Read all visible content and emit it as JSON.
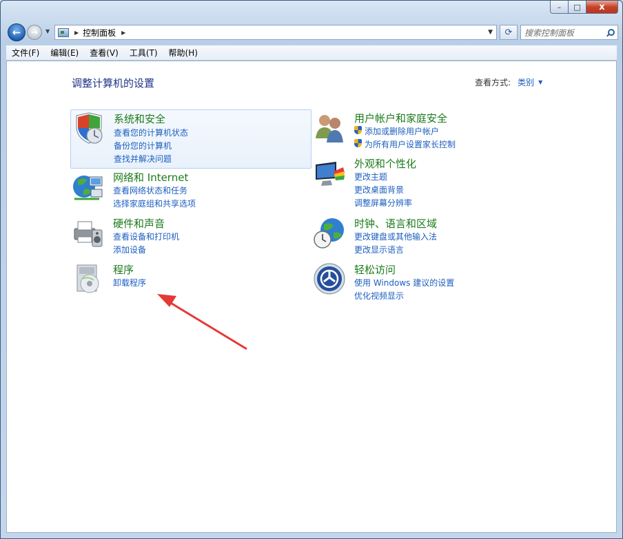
{
  "window": {
    "caption_buttons": {
      "minimize": "–",
      "maximize": "□",
      "close": "x"
    }
  },
  "navigation": {
    "back": "←",
    "forward": "→",
    "address_path": "控制面板",
    "search_placeholder": "搜索控制面板"
  },
  "menu": [
    "文件(F)",
    "编辑(E)",
    "查看(V)",
    "工具(T)",
    "帮助(H)"
  ],
  "page": {
    "title": "调整计算机的设置",
    "view_by_label": "查看方式:",
    "view_by_value": "类别"
  },
  "categories": {
    "system_security": {
      "title": "系统和安全",
      "icon": "shield-icon",
      "links": [
        "查看您的计算机状态",
        "备份您的计算机",
        "查找并解决问题"
      ]
    },
    "network": {
      "title": "网络和 Internet",
      "icon": "network-globe-icon",
      "links": [
        "查看网络状态和任务",
        "选择家庭组和共享选项"
      ]
    },
    "hardware_sound": {
      "title": "硬件和声音",
      "icon": "printer-speaker-icon",
      "links": [
        "查看设备和打印机",
        "添加设备"
      ]
    },
    "programs": {
      "title": "程序",
      "icon": "programs-disc-icon",
      "links": [
        "卸载程序"
      ]
    },
    "user_accounts": {
      "title": "用户帐户和家庭安全",
      "icon": "users-icon",
      "links": [
        "添加或删除用户帐户",
        "为所有用户设置家长控制"
      ]
    },
    "appearance": {
      "title": "外观和个性化",
      "icon": "monitor-palette-icon",
      "links": [
        "更改主题",
        "更改桌面背景",
        "调整屏幕分辨率"
      ]
    },
    "clock_region": {
      "title": "时钟、语言和区域",
      "icon": "clock-globe-icon",
      "links": [
        "更改键盘或其他输入法",
        "更改显示语言"
      ]
    },
    "ease_of_access": {
      "title": "轻松访问",
      "icon": "ease-of-access-icon",
      "links": [
        "使用 Windows 建议的设置",
        "优化视频显示"
      ]
    }
  },
  "annotation": {
    "arrow_color": "#e53935"
  }
}
